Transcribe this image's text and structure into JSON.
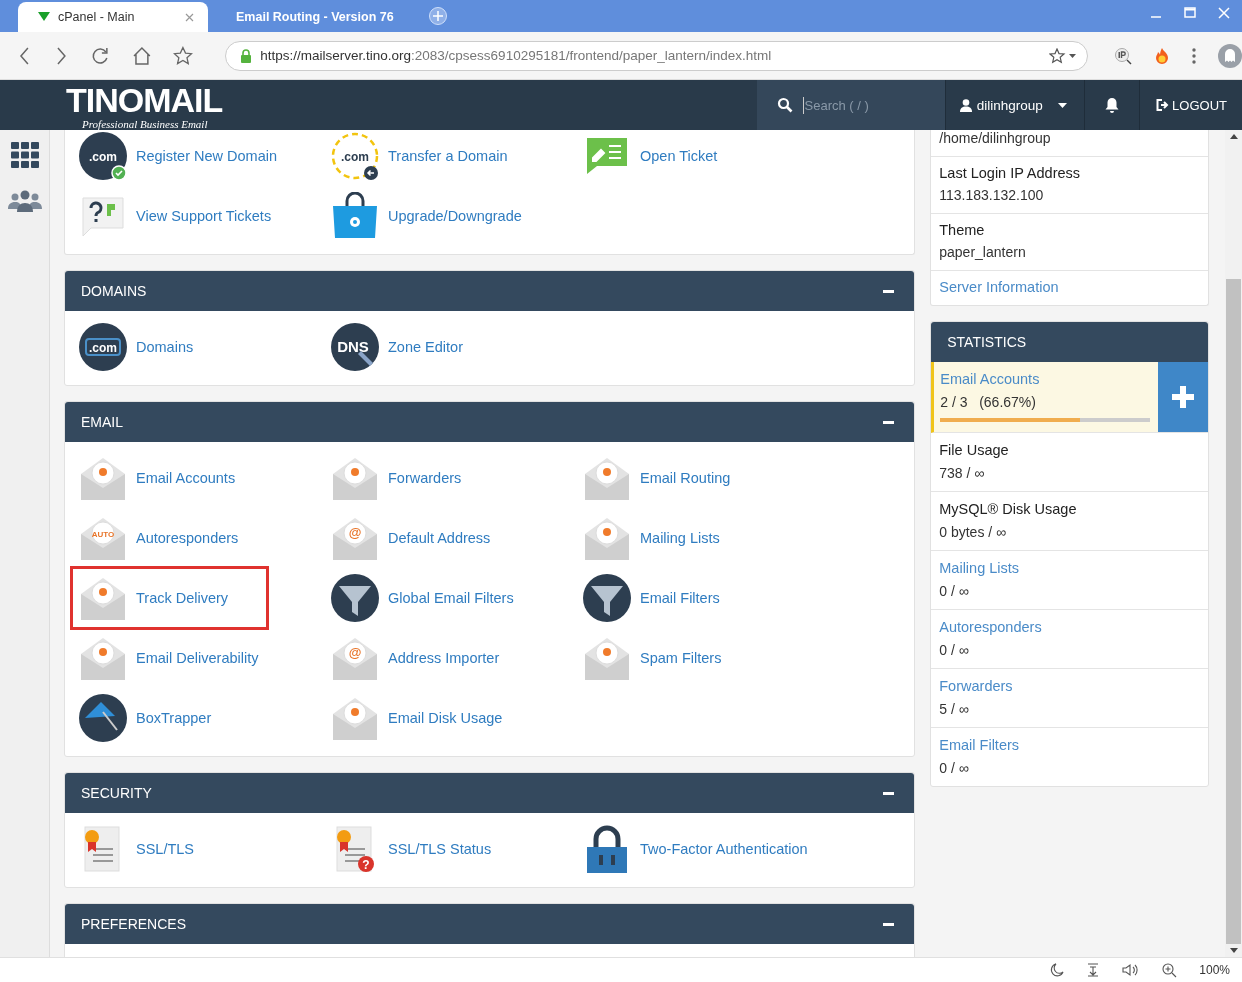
{
  "browser": {
    "tabs": [
      {
        "title": "cPanel - Main",
        "selected": true
      },
      {
        "title": "Email Routing - Version 76",
        "selected": false
      }
    ],
    "url_host": "https://mailserver.tino.org",
    "url_path": ":2083/cpsess6910295181/frontend/paper_lantern/index.html",
    "zoom": "100%"
  },
  "header": {
    "logo": "TINOMAIL",
    "tagline": "Professional Business Email",
    "search_placeholder": "Search ( / )",
    "user": "dilinhgroup",
    "logout": "LOGOUT"
  },
  "sections": [
    {
      "items": [
        {
          "label": "Register New Domain",
          "kind": "dotcom",
          "badge": ".com",
          "highlighted": false
        },
        {
          "label": "Transfer a Domain",
          "kind": "transfer",
          "badge": ".com",
          "highlighted": false
        },
        {
          "label": "Open Ticket",
          "kind": "ticket",
          "highlighted": false
        },
        {
          "label": "View Support Tickets",
          "kind": "help",
          "highlighted": false
        },
        {
          "label": "Upgrade/Downgrade",
          "kind": "upgrade",
          "highlighted": false
        }
      ]
    },
    {
      "title": "DOMAINS",
      "items": [
        {
          "label": "Domains",
          "kind": "dotcom",
          "badge": ".com",
          "highlighted": false
        },
        {
          "label": "Zone Editor",
          "kind": "dns",
          "badge": "DNS",
          "highlighted": false
        }
      ]
    },
    {
      "title": "EMAIL",
      "items": [
        {
          "label": "Email Accounts",
          "kind": "envelope",
          "highlighted": false
        },
        {
          "label": "Forwarders",
          "kind": "envelope",
          "highlighted": false
        },
        {
          "label": "Email Routing",
          "kind": "envelope",
          "highlighted": false
        },
        {
          "label": "Autoresponders",
          "kind": "envelope",
          "badge": "AUTO",
          "highlighted": false
        },
        {
          "label": "Default Address",
          "kind": "envelope",
          "badge": "@",
          "highlighted": false
        },
        {
          "label": "Mailing Lists",
          "kind": "envelope",
          "highlighted": false
        },
        {
          "label": "Track Delivery",
          "kind": "envelope",
          "highlighted": true
        },
        {
          "label": "Global Email Filters",
          "kind": "funnel",
          "highlighted": false
        },
        {
          "label": "Email Filters",
          "kind": "funnel",
          "highlighted": false
        },
        {
          "label": "Email Deliverability",
          "kind": "envelope",
          "highlighted": false
        },
        {
          "label": "Address Importer",
          "kind": "envelope",
          "badge": "@",
          "highlighted": false
        },
        {
          "label": "Spam Filters",
          "kind": "envelope",
          "highlighted": false
        },
        {
          "label": "BoxTrapper",
          "kind": "umbrella",
          "highlighted": false
        },
        {
          "label": "Email Disk Usage",
          "kind": "envelope",
          "highlighted": false
        }
      ]
    },
    {
      "title": "SECURITY",
      "items": [
        {
          "label": "SSL/TLS",
          "kind": "certificate",
          "highlighted": false
        },
        {
          "label": "SSL/TLS Status",
          "kind": "certificate",
          "badge": "?",
          "highlighted": false
        },
        {
          "label": "Two-Factor Authentication",
          "kind": "lock",
          "highlighted": false
        }
      ]
    },
    {
      "title": "PREFERENCES"
    }
  ],
  "info": [
    {
      "value": "/home/dilinhgroup"
    },
    {
      "label": "Last Login IP Address",
      "value": "113.183.132.100"
    },
    {
      "label": "Theme",
      "value": "paper_lantern"
    }
  ],
  "info_link": "Server Information",
  "statistics": {
    "title": "STATISTICS",
    "items": [
      {
        "label": "Email Accounts",
        "value": "2 / 3   (66.67%)",
        "link": true,
        "level": 0.6667,
        "highlighted": true
      },
      {
        "label": "File Usage",
        "value": "738 / ∞",
        "link": false,
        "highlighted": false
      },
      {
        "label": "MySQL® Disk Usage",
        "value": "0 bytes / ∞",
        "link": false,
        "highlighted": false
      },
      {
        "label": "Mailing Lists",
        "value": "0 / ∞",
        "link": true,
        "highlighted": false
      },
      {
        "label": "Autoresponders",
        "value": "0 / ∞",
        "link": true,
        "highlighted": false
      },
      {
        "label": "Forwarders",
        "value": "5 / ∞",
        "link": true,
        "highlighted": false
      },
      {
        "label": "Email Filters",
        "value": "0 / ∞",
        "link": true,
        "highlighted": false
      }
    ]
  }
}
